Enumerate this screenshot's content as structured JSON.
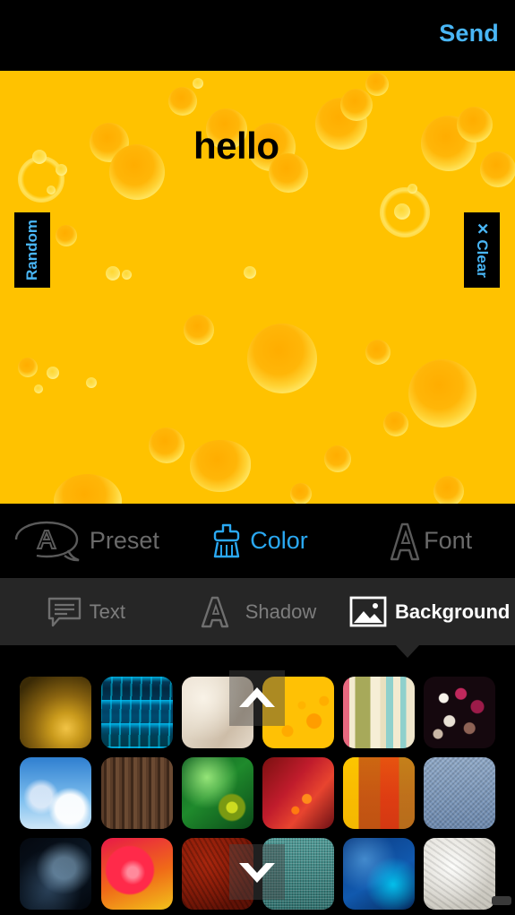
{
  "topbar": {
    "send_label": "Send"
  },
  "canvas": {
    "text": "hello",
    "background_color": "#FFC200",
    "random_label": "Random",
    "clear_label": "Clear",
    "clear_icon": "x-icon",
    "accent_color": "#49B6F6"
  },
  "main_toolbar": {
    "items": [
      {
        "label": "Preset",
        "icon": "speech-bubble-a-icon",
        "active": false
      },
      {
        "label": "Color",
        "icon": "brush-icon",
        "active": true
      },
      {
        "label": "Font",
        "icon": "letter-a-icon",
        "active": false
      }
    ],
    "active_color": "#2AA8F2",
    "inactive_color": "#6A6A6A"
  },
  "sub_toolbar": {
    "items": [
      {
        "label": "Text",
        "icon": "text-bubble-icon",
        "active": false
      },
      {
        "label": "Shadow",
        "icon": "shadow-a-icon",
        "active": false
      },
      {
        "label": "Background",
        "icon": "image-icon",
        "active": true
      }
    ],
    "background_color": "#262626"
  },
  "grid": {
    "scroll_up_icon": "chevron-up-icon",
    "scroll_down_icon": "chevron-down-icon",
    "selected_index": 3,
    "thumbnails": [
      {
        "name": "gold-bokeh"
      },
      {
        "name": "blue-particle-rain"
      },
      {
        "name": "beige-parchment"
      },
      {
        "name": "yellow-bubbles"
      },
      {
        "name": "pastel-stripes"
      },
      {
        "name": "magenta-dots"
      },
      {
        "name": "dandelion-sky"
      },
      {
        "name": "dark-wood"
      },
      {
        "name": "green-music-abstract"
      },
      {
        "name": "red-spark-burst"
      },
      {
        "name": "orange-grunge-collage"
      },
      {
        "name": "blue-denim-texture"
      },
      {
        "name": "dark-blue-swirl"
      },
      {
        "name": "red-glossy-circles"
      },
      {
        "name": "red-grunge"
      },
      {
        "name": "teal-burlap"
      },
      {
        "name": "blue-ice-texture"
      },
      {
        "name": "gray-stone"
      }
    ]
  }
}
